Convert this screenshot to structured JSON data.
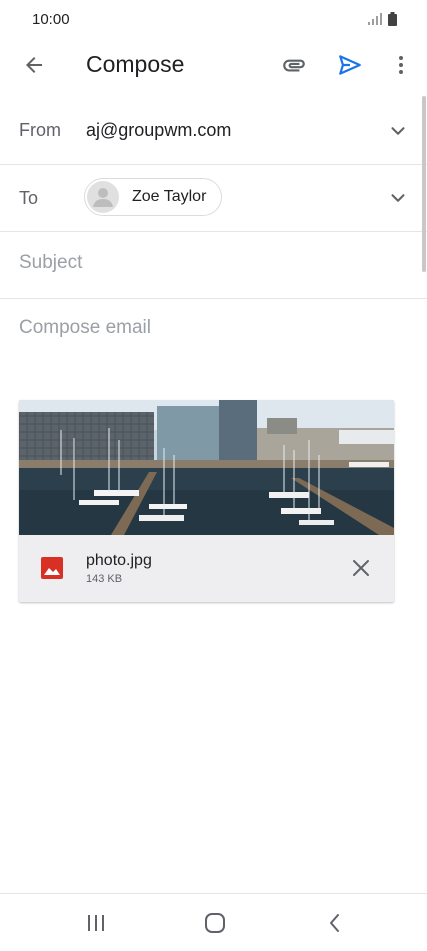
{
  "status_bar": {
    "time": "10:00"
  },
  "app_bar": {
    "title": "Compose"
  },
  "from": {
    "label": "From",
    "value": "aj@groupwm.com"
  },
  "to": {
    "label": "To",
    "recipient": "Zoe Taylor"
  },
  "subject": {
    "placeholder": "Subject",
    "value": ""
  },
  "body": {
    "placeholder": "Compose email",
    "value": ""
  },
  "attachment": {
    "name": "photo.jpg",
    "size": "143 KB"
  },
  "colors": {
    "accent": "#1a73e8",
    "image_icon": "#d93025"
  },
  "icons": {
    "back": "arrow-left-icon",
    "attach": "paperclip-icon",
    "send": "send-icon",
    "more": "more-vert-icon",
    "expand": "chevron-down-icon",
    "file": "image-file-icon",
    "remove": "close-icon"
  }
}
